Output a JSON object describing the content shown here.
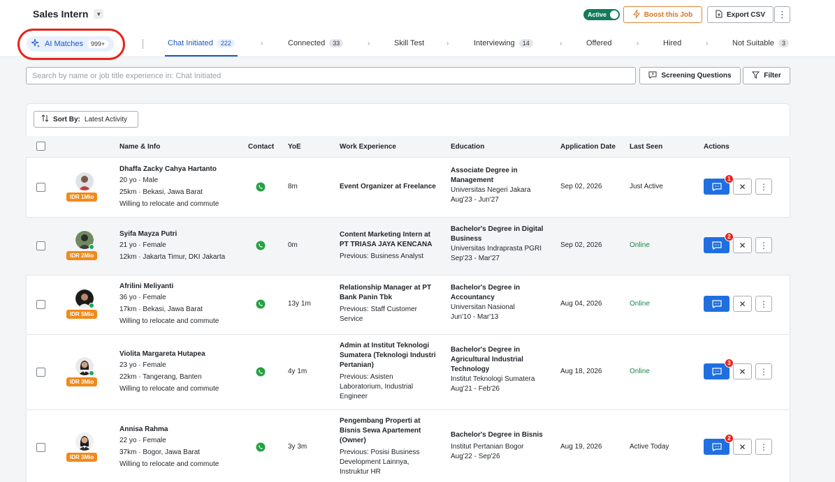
{
  "header": {
    "job_title": "Sales Intern",
    "status_label": "Active",
    "boost_label": "Boost this Job",
    "export_label": "Export CSV"
  },
  "tabs": [
    {
      "label": "AI Matches",
      "count": "999+"
    },
    {
      "label": "Chat Initiated",
      "count": "222"
    },
    {
      "label": "Connected",
      "count": "33"
    },
    {
      "label": "Skill Test",
      "count": ""
    },
    {
      "label": "Interviewing",
      "count": "14"
    },
    {
      "label": "Offered",
      "count": ""
    },
    {
      "label": "Hired",
      "count": ""
    },
    {
      "label": "Not Suitable",
      "count": "3"
    }
  ],
  "toolbar": {
    "search_placeholder": "Search by name or job title experience in: Chat Initiated",
    "screening_label": "Screening Questions",
    "filter_label": "Filter",
    "sort_label": "Sort By:",
    "sort_value": "Latest Activity"
  },
  "table": {
    "columns": [
      "Name & Info",
      "Contact",
      "YoE",
      "Work Experience",
      "Education",
      "Application Date",
      "Last Seen",
      "Actions"
    ],
    "rows": [
      {
        "name": "Dhaffa Zacky Cahya Hartanto",
        "age_gender": "20 yo · Male",
        "distance_location": "25km · Bekasi, Jawa Barat",
        "relocate": "Willing to relocate and commute",
        "salary": "IDR 1Mio",
        "yoe": "8m",
        "work_title": "Event Organizer at Freelance",
        "work_previous": "",
        "edu_degree": "Associate Degree in Management",
        "edu_school": "Universitas Negeri Jakara",
        "edu_period": "Aug'23 - Jun'27",
        "application_date": "Sep 02, 2026",
        "last_seen": "Just Active",
        "online": false,
        "unread": "1"
      },
      {
        "name": "Syifa Mayza Putri",
        "age_gender": "21 yo · Female",
        "distance_location": "12km · Jakarta Timur, DKI Jakarta",
        "relocate": "",
        "salary": "IDR 2Mio",
        "yoe": "0m",
        "work_title": "Content Marketing Intern at PT TRIASA JAYA KENCANA",
        "work_previous": "Previous: Business Analyst",
        "edu_degree": "Bachelor's Degree in Digital Business",
        "edu_school": "Universitas Indraprasta PGRI",
        "edu_period": "Sep'23 - Mar'27",
        "application_date": "Sep 02, 2026",
        "last_seen": "Online",
        "online": true,
        "unread": "2"
      },
      {
        "name": "Afrilini Meliyanti",
        "age_gender": "36 yo · Female",
        "distance_location": "17km · Bekasi, Jawa Barat",
        "relocate": "Willing to relocate and commute",
        "salary": "IDR 5Mio",
        "yoe": "13y 1m",
        "work_title": "Relationship Manager at PT Bank Panin Tbk",
        "work_previous": "Previous: Staff Customer Service",
        "edu_degree": "Bachelor's Degree in Accountancy",
        "edu_school": "Universitan Nasional",
        "edu_period": "Jun'10 - Mar'13",
        "application_date": "Aug 04, 2026",
        "last_seen": "Online",
        "online": true,
        "unread": ""
      },
      {
        "name": "Violita Margareta Hutapea",
        "age_gender": "23 yo · Female",
        "distance_location": "22km · Tangerang, Banten",
        "relocate": "Willing to relocate and commute",
        "salary": "IDR 3Mio",
        "yoe": "4y 1m",
        "work_title": "Admin at Institut Teknologi Sumatera (Teknologi Industri Pertanian)",
        "work_previous": "Previous: Asisten Laboratorium, Industrial Engineer",
        "edu_degree": "Bachelor's Degree in Agricultural Industrial Technology",
        "edu_school": "Institut Teknologi Sumatera",
        "edu_period": "Aug'21 - Feb'26",
        "application_date": "Aug 18, 2026",
        "last_seen": "Online",
        "online": true,
        "unread": "3"
      },
      {
        "name": "Annisa Rahma",
        "age_gender": "22 yo · Female",
        "distance_location": "37km · Bogor, Jawa Barat",
        "relocate": "Willing to relocate and commute",
        "salary": "IDR 3Mio",
        "yoe": "3y 3m",
        "work_title": "Pengembang Properti at Bisnis Sewa Apartement (Owner)",
        "work_previous": "Previous: Posisi Business Development Lainnya, Instruktur HR",
        "edu_degree": "Bachelor's Degree in Bisnis",
        "edu_school": "Institut Pertanian Bogor",
        "edu_period": "Aug'22 - Sep'26",
        "application_date": "Aug 19, 2026",
        "last_seen": "Active Today",
        "online": false,
        "unread": "2"
      }
    ]
  },
  "colors": {
    "primary": "#1f6fe0",
    "accent_orange": "#f08a1c",
    "online_green": "#17864a",
    "status_green": "#137a5b",
    "highlight_red": "#e8231c"
  }
}
